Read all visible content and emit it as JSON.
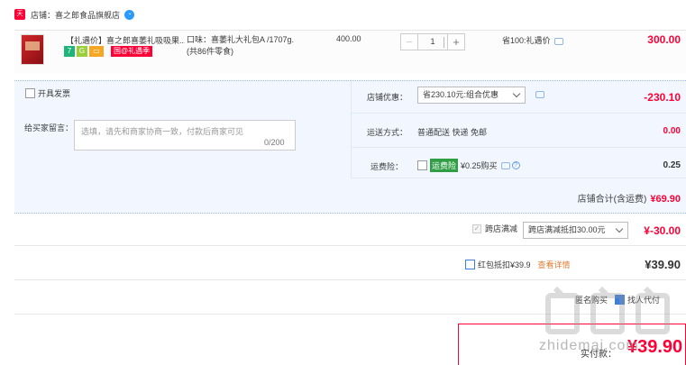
{
  "shop": {
    "badge": "天猫",
    "name": "店铺：喜之郎食品旗舰店",
    "ww_icon": "ww-chat-icon"
  },
  "item": {
    "title": "【礼遇价】喜之郎喜萎礼吸吸果...",
    "tags": [
      "7",
      "G",
      "▭"
    ],
    "gift_tag": "国@礼遇季",
    "sku_line1": "口味：喜萎礼大礼包A /1707g.",
    "sku_line2": "(共86件零食)",
    "unit_price": "400.00",
    "qty_minus": "−",
    "qty": "1",
    "qty_plus": "+",
    "save_label": "省100:礼遇价",
    "total": "300.00"
  },
  "options": {
    "invoice_label": "开具发票",
    "message_label": "给买家留言：",
    "message_placeholder": "选填，请先和商家协商一致，付款后商家可见",
    "message_count": "0/200",
    "discount_label": "店铺优惠：",
    "discount_selected": "省230.10元:组合优惠",
    "discount_value": "-230.10",
    "delivery_label": "运送方式：",
    "delivery_value": "普通配送 快递 免邮",
    "delivery_fee": "0.00",
    "insurance_label": "运费险：",
    "insurance_badge": "运费险",
    "insurance_text": "¥0.25购买",
    "insurance_help": "?",
    "insurance_value": "0.25",
    "shop_total_label": "店铺合计(含运费)",
    "shop_total_value": "¥69.90"
  },
  "cross_store": {
    "label": "跨店满减",
    "check": "✓",
    "selected": "跨店满减抵扣30.00元",
    "value": "¥-30.00"
  },
  "red_packet": {
    "label": "红包抵扣¥39.9",
    "link": "查看详情",
    "value": "¥39.90"
  },
  "pay": {
    "label1": "匿名购买",
    "label2": "找人代付"
  },
  "total": {
    "label": "实付款：",
    "value": "¥39.90"
  },
  "watermark": "zhidemai.com"
}
